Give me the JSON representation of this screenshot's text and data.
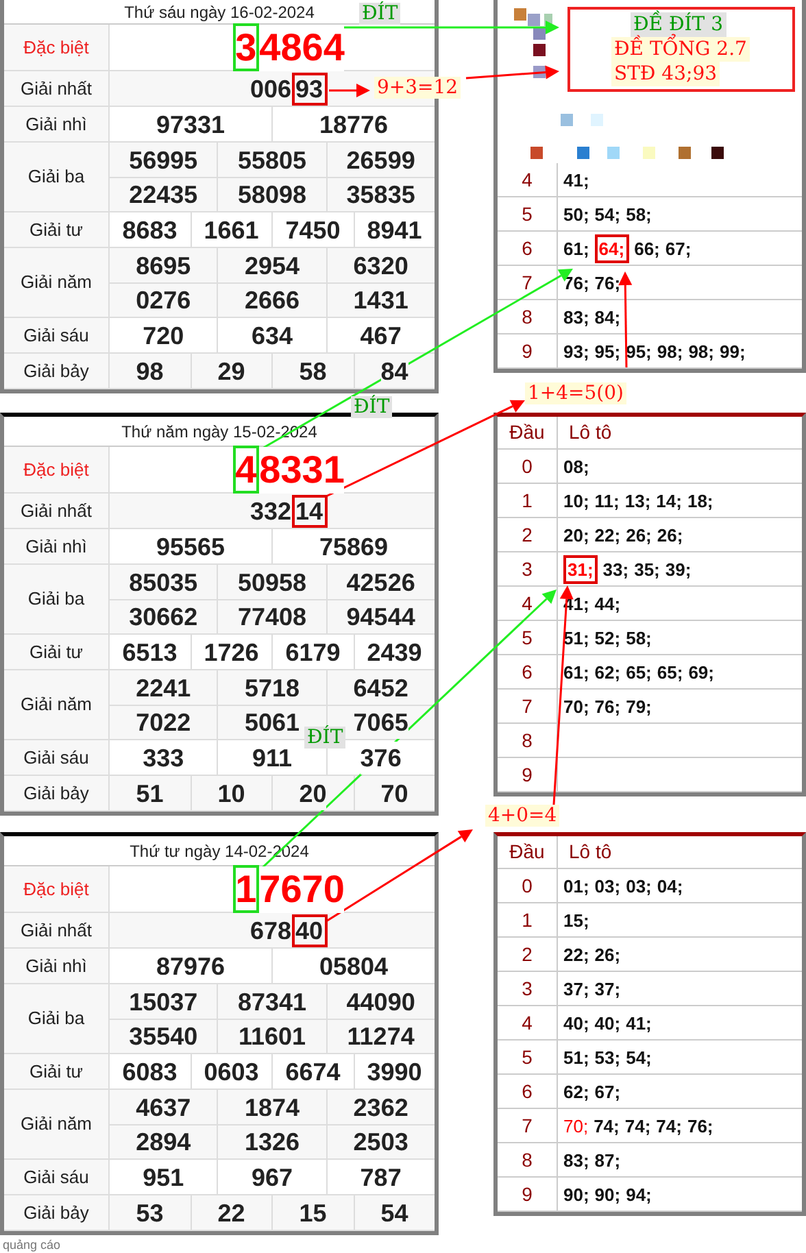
{
  "draws": [
    {
      "date": "Thứ sáu ngày 16-02-2024",
      "prizes": [
        {
          "label": "Đặc biệt",
          "kind": "special",
          "head_boxed": true,
          "tail_boxed": false,
          "rows": [
            [
              "34864"
            ]
          ]
        },
        {
          "label": "Giải nhất",
          "kind": "normal",
          "head_boxed": false,
          "tail_boxed": true,
          "rows": [
            [
              "00693"
            ]
          ]
        },
        {
          "label": "Giải nhì",
          "kind": "normal",
          "head_boxed": false,
          "tail_boxed": false,
          "rows": [
            [
              "97331",
              "18776"
            ]
          ]
        },
        {
          "label": "Giải ba",
          "kind": "normal",
          "head_boxed": false,
          "tail_boxed": false,
          "rows": [
            [
              "56995",
              "55805",
              "26599"
            ],
            [
              "22435",
              "58098",
              "35835"
            ]
          ]
        },
        {
          "label": "Giải tư",
          "kind": "normal",
          "head_boxed": false,
          "tail_boxed": false,
          "rows": [
            [
              "8683",
              "1661",
              "7450",
              "8941"
            ]
          ]
        },
        {
          "label": "Giải năm",
          "kind": "normal",
          "head_boxed": false,
          "tail_boxed": false,
          "rows": [
            [
              "8695",
              "2954",
              "6320"
            ],
            [
              "0276",
              "2666",
              "1431"
            ]
          ]
        },
        {
          "label": "Giải sáu",
          "kind": "normal",
          "head_boxed": false,
          "tail_boxed": false,
          "rows": [
            [
              "720",
              "634",
              "467"
            ]
          ]
        },
        {
          "label": "Giải bảy",
          "kind": "normal",
          "head_boxed": false,
          "tail_boxed": false,
          "rows": [
            [
              "98",
              "29",
              "58",
              "84"
            ]
          ]
        }
      ],
      "loto": {
        "rows": [
          {
            "head": "4",
            "numbers": [
              {
                "text": "41;",
                "boxed": false,
                "red": false
              }
            ]
          },
          {
            "head": "5",
            "numbers": [
              {
                "text": "50;",
                "boxed": false,
                "red": false
              },
              {
                "text": "54;",
                "boxed": false,
                "red": false
              },
              {
                "text": "58;",
                "boxed": false,
                "red": false
              }
            ]
          },
          {
            "head": "6",
            "numbers": [
              {
                "text": "61;",
                "boxed": false,
                "red": false
              },
              {
                "text": "64;",
                "boxed": true,
                "red": true
              },
              {
                "text": "66;",
                "boxed": false,
                "red": false
              },
              {
                "text": "67;",
                "boxed": false,
                "red": false
              }
            ]
          },
          {
            "head": "7",
            "numbers": [
              {
                "text": "76;",
                "boxed": false,
                "red": false
              },
              {
                "text": "76;",
                "boxed": false,
                "red": false
              }
            ]
          },
          {
            "head": "8",
            "numbers": [
              {
                "text": "83;",
                "boxed": false,
                "red": false
              },
              {
                "text": "84;",
                "boxed": false,
                "red": false
              }
            ]
          },
          {
            "head": "9",
            "numbers": [
              {
                "text": "93;",
                "boxed": false,
                "red": false
              },
              {
                "text": "95;",
                "boxed": false,
                "red": false
              },
              {
                "text": "95;",
                "boxed": false,
                "red": false
              },
              {
                "text": "98;",
                "boxed": false,
                "red": false
              },
              {
                "text": "98;",
                "boxed": false,
                "red": false
              },
              {
                "text": "99;",
                "boxed": false,
                "red": false
              }
            ]
          }
        ]
      }
    },
    {
      "date": "Thứ năm ngày 15-02-2024",
      "prizes": [
        {
          "label": "Đặc biệt",
          "kind": "special",
          "head_boxed": true,
          "tail_boxed": false,
          "rows": [
            [
              "48331"
            ]
          ]
        },
        {
          "label": "Giải nhất",
          "kind": "normal",
          "head_boxed": false,
          "tail_boxed": true,
          "rows": [
            [
              "33214"
            ]
          ]
        },
        {
          "label": "Giải nhì",
          "kind": "normal",
          "head_boxed": false,
          "tail_boxed": false,
          "rows": [
            [
              "95565",
              "75869"
            ]
          ]
        },
        {
          "label": "Giải ba",
          "kind": "normal",
          "head_boxed": false,
          "tail_boxed": false,
          "rows": [
            [
              "85035",
              "50958",
              "42526"
            ],
            [
              "30662",
              "77408",
              "94544"
            ]
          ]
        },
        {
          "label": "Giải tư",
          "kind": "normal",
          "head_boxed": false,
          "tail_boxed": false,
          "rows": [
            [
              "6513",
              "1726",
              "6179",
              "2439"
            ]
          ]
        },
        {
          "label": "Giải năm",
          "kind": "normal",
          "head_boxed": false,
          "tail_boxed": false,
          "rows": [
            [
              "2241",
              "5718",
              "6452"
            ],
            [
              "7022",
              "5061",
              "7065"
            ]
          ]
        },
        {
          "label": "Giải sáu",
          "kind": "normal",
          "head_boxed": false,
          "tail_boxed": false,
          "rows": [
            [
              "333",
              "911",
              "376"
            ]
          ]
        },
        {
          "label": "Giải bảy",
          "kind": "normal",
          "head_boxed": false,
          "tail_boxed": false,
          "rows": [
            [
              "51",
              "10",
              "20",
              "70"
            ]
          ]
        }
      ],
      "loto": {
        "head_title": "Đầu",
        "numbers_title": "Lô tô",
        "rows": [
          {
            "head": "0",
            "numbers": [
              {
                "text": "08;",
                "boxed": false,
                "red": false
              }
            ]
          },
          {
            "head": "1",
            "numbers": [
              {
                "text": "10;",
                "boxed": false,
                "red": false
              },
              {
                "text": "11;",
                "boxed": false,
                "red": false
              },
              {
                "text": "13;",
                "boxed": false,
                "red": false
              },
              {
                "text": "14;",
                "boxed": false,
                "red": false
              },
              {
                "text": "18;",
                "boxed": false,
                "red": false
              }
            ]
          },
          {
            "head": "2",
            "numbers": [
              {
                "text": "20;",
                "boxed": false,
                "red": false
              },
              {
                "text": "22;",
                "boxed": false,
                "red": false
              },
              {
                "text": "26;",
                "boxed": false,
                "red": false
              },
              {
                "text": "26;",
                "boxed": false,
                "red": false
              }
            ]
          },
          {
            "head": "3",
            "numbers": [
              {
                "text": "31;",
                "boxed": true,
                "red": true
              },
              {
                "text": "33;",
                "boxed": false,
                "red": false
              },
              {
                "text": "35;",
                "boxed": false,
                "red": false
              },
              {
                "text": "39;",
                "boxed": false,
                "red": false
              }
            ]
          },
          {
            "head": "4",
            "numbers": [
              {
                "text": "41;",
                "boxed": false,
                "red": false
              },
              {
                "text": "44;",
                "boxed": false,
                "red": false
              }
            ]
          },
          {
            "head": "5",
            "numbers": [
              {
                "text": "51;",
                "boxed": false,
                "red": false
              },
              {
                "text": "52;",
                "boxed": false,
                "red": false
              },
              {
                "text": "58;",
                "boxed": false,
                "red": false
              }
            ]
          },
          {
            "head": "6",
            "numbers": [
              {
                "text": "61;",
                "boxed": false,
                "red": false
              },
              {
                "text": "62;",
                "boxed": false,
                "red": false
              },
              {
                "text": "65;",
                "boxed": false,
                "red": false
              },
              {
                "text": "65;",
                "boxed": false,
                "red": false
              },
              {
                "text": "69;",
                "boxed": false,
                "red": false
              }
            ]
          },
          {
            "head": "7",
            "numbers": [
              {
                "text": "70;",
                "boxed": false,
                "red": false
              },
              {
                "text": "76;",
                "boxed": false,
                "red": false
              },
              {
                "text": "79;",
                "boxed": false,
                "red": false
              }
            ]
          },
          {
            "head": "8"
          },
          {
            "head": "9"
          }
        ]
      }
    },
    {
      "date": "Thứ tư ngày 14-02-2024",
      "prizes": [
        {
          "label": "Đặc biệt",
          "kind": "special",
          "head_boxed": true,
          "tail_boxed": false,
          "rows": [
            [
              "17670"
            ]
          ]
        },
        {
          "label": "Giải nhất",
          "kind": "normal",
          "head_boxed": false,
          "tail_boxed": true,
          "rows": [
            [
              "67840"
            ]
          ]
        },
        {
          "label": "Giải nhì",
          "kind": "normal",
          "head_boxed": false,
          "tail_boxed": false,
          "rows": [
            [
              "87976",
              "05804"
            ]
          ]
        },
        {
          "label": "Giải ba",
          "kind": "normal",
          "head_boxed": false,
          "tail_boxed": false,
          "rows": [
            [
              "15037",
              "87341",
              "44090"
            ],
            [
              "35540",
              "11601",
              "11274"
            ]
          ]
        },
        {
          "label": "Giải tư",
          "kind": "normal",
          "head_boxed": false,
          "tail_boxed": false,
          "rows": [
            [
              "6083",
              "0603",
              "6674",
              "3990"
            ]
          ]
        },
        {
          "label": "Giải năm",
          "kind": "normal",
          "head_boxed": false,
          "tail_boxed": false,
          "rows": [
            [
              "4637",
              "1874",
              "2362"
            ],
            [
              "2894",
              "1326",
              "2503"
            ]
          ]
        },
        {
          "label": "Giải sáu",
          "kind": "normal",
          "head_boxed": false,
          "tail_boxed": false,
          "rows": [
            [
              "951",
              "967",
              "787"
            ]
          ]
        },
        {
          "label": "Giải bảy",
          "kind": "normal",
          "head_boxed": false,
          "tail_boxed": false,
          "rows": [
            [
              "53",
              "22",
              "15",
              "54"
            ]
          ]
        }
      ],
      "loto": {
        "head_title": "Đầu",
        "numbers_title": "Lô tô",
        "rows": [
          {
            "head": "0",
            "numbers": [
              {
                "text": "01;",
                "boxed": false,
                "red": false
              },
              {
                "text": "03;",
                "boxed": false,
                "red": false
              },
              {
                "text": "03;",
                "boxed": false,
                "red": false
              },
              {
                "text": "04;",
                "boxed": false,
                "red": false
              }
            ]
          },
          {
            "head": "1",
            "numbers": [
              {
                "text": "15;",
                "boxed": false,
                "red": false
              }
            ]
          },
          {
            "head": "2",
            "numbers": [
              {
                "text": "22;",
                "boxed": false,
                "red": false
              },
              {
                "text": "26;",
                "boxed": false,
                "red": false
              }
            ]
          },
          {
            "head": "3",
            "numbers": [
              {
                "text": "37;",
                "boxed": false,
                "red": false
              },
              {
                "text": "37;",
                "boxed": false,
                "red": false
              }
            ]
          },
          {
            "head": "4",
            "numbers": [
              {
                "text": "40;",
                "boxed": false,
                "red": false
              },
              {
                "text": "40;",
                "boxed": false,
                "red": false
              },
              {
                "text": "41;",
                "boxed": false,
                "red": false
              }
            ]
          },
          {
            "head": "5",
            "numbers": [
              {
                "text": "51;",
                "boxed": false,
                "red": false
              },
              {
                "text": "53;",
                "boxed": false,
                "red": false
              },
              {
                "text": "54;",
                "boxed": false,
                "red": false
              }
            ]
          },
          {
            "head": "6",
            "numbers": [
              {
                "text": "62;",
                "boxed": false,
                "red": false
              },
              {
                "text": "67;",
                "boxed": false,
                "red": false
              }
            ]
          },
          {
            "head": "7",
            "numbers": [
              {
                "text": "70;",
                "boxed": false,
                "red": true
              },
              {
                "text": "74;",
                "boxed": false,
                "red": false
              },
              {
                "text": "74;",
                "boxed": false,
                "red": false
              },
              {
                "text": "74;",
                "boxed": false,
                "red": false
              },
              {
                "text": "76;",
                "boxed": false,
                "red": false
              }
            ]
          },
          {
            "head": "8",
            "numbers": [
              {
                "text": "83;",
                "boxed": false,
                "red": false
              },
              {
                "text": "87;",
                "boxed": false,
                "red": false
              }
            ]
          },
          {
            "head": "9",
            "numbers": [
              {
                "text": "90;",
                "boxed": false,
                "red": false
              },
              {
                "text": "90;",
                "boxed": false,
                "red": false
              },
              {
                "text": "94;",
                "boxed": false,
                "red": false
              }
            ]
          }
        ]
      }
    }
  ],
  "annotations": [
    {
      "kind": "dit",
      "text": "ĐÍT"
    },
    {
      "kind": "sum",
      "text": "9+3=12"
    },
    {
      "kind": "dit",
      "text": "ĐÍT"
    },
    {
      "kind": "sum",
      "text": "1+4=5(0)"
    },
    {
      "kind": "dit",
      "text": "ĐÍT"
    },
    {
      "kind": "sum",
      "text": "4+0=4"
    }
  ],
  "note_box": {
    "lines": [
      {
        "kind": "dit",
        "text": "ĐỀ ĐÍT 3"
      },
      {
        "kind": "sum",
        "text": "ĐỀ TỔNG 2.7"
      },
      {
        "kind": "sum",
        "text": "STĐ 43;93"
      }
    ]
  },
  "ad_label": "quảng cáo"
}
